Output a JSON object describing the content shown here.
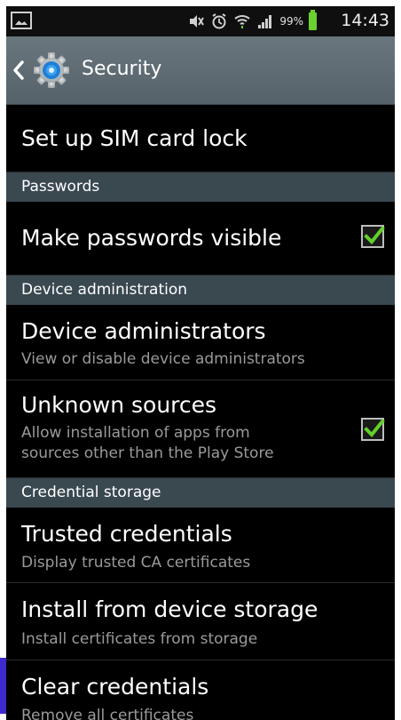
{
  "status_bar": {
    "battery_percent": "99%",
    "time": "14:43",
    "icons": [
      "gallery-icon",
      "mute-icon",
      "alarm-icon",
      "wifi-icon",
      "signal-icon",
      "battery-icon"
    ]
  },
  "action_bar": {
    "title": "Security",
    "back_icon": "chevron-left-icon",
    "app_icon": "settings-gear-icon"
  },
  "items": {
    "sim_lock": {
      "title": "Set up SIM card lock"
    },
    "passwords_header": {
      "label": "Passwords"
    },
    "make_passwords_visible": {
      "title": "Make passwords visible",
      "checked": true
    },
    "device_admin_header": {
      "label": "Device administration"
    },
    "device_administrators": {
      "title": "Device administrators",
      "summary": "View or disable device administrators"
    },
    "unknown_sources": {
      "title": "Unknown sources",
      "summary_line1": "Allow installation of apps from",
      "summary_line2": "sources other than the Play Store",
      "checked": true
    },
    "credential_header": {
      "label": "Credential storage"
    },
    "trusted_credentials": {
      "title": "Trusted credentials",
      "summary": "Display trusted CA certificates"
    },
    "install_from_storage": {
      "title": "Install from device storage",
      "summary": "Install certificates from storage"
    },
    "clear_credentials": {
      "title": "Clear credentials",
      "summary": "Remove all certificates"
    }
  },
  "colors": {
    "action_bar": "#5e6b73",
    "section_header": "#3a4850",
    "checkmark": "#62d02b",
    "battery": "#6ad12f"
  }
}
